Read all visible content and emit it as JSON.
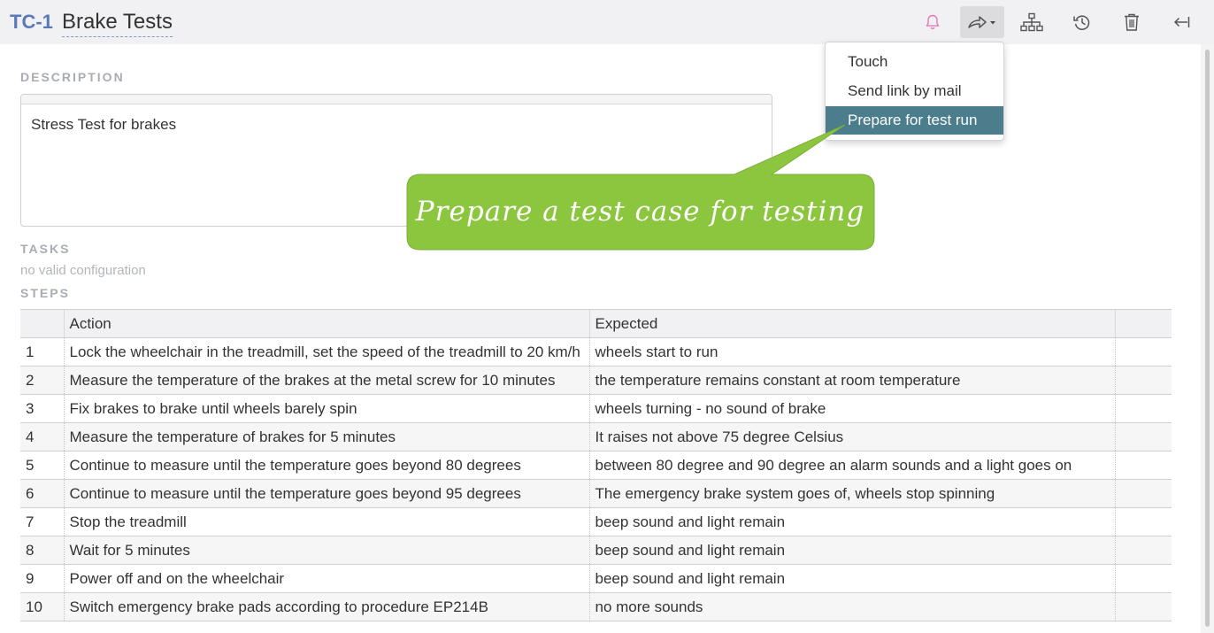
{
  "header": {
    "id": "TC-1",
    "title": "Brake Tests"
  },
  "toolbar": {
    "icons": [
      "bell-icon",
      "share-icon",
      "hierarchy-icon",
      "history-icon",
      "trash-icon",
      "collapse-left-icon"
    ],
    "accent": "#e879b6"
  },
  "description": {
    "label": "DESCRIPTION",
    "text": "Stress Test for brakes"
  },
  "tasks": {
    "label": "TASKS",
    "note": "no valid configuration"
  },
  "steps": {
    "label": "STEPS",
    "columns": [
      "",
      "Action",
      "Expected",
      ""
    ],
    "rows": [
      {
        "num": "1",
        "action": "Lock the wheelchair in the treadmill, set the speed of the treadmill to 20 km/h",
        "expected": "wheels start to run"
      },
      {
        "num": "2",
        "action": "Measure the temperature of the brakes at the metal screw for 10 minutes",
        "expected": "the temperature remains constant at room temperature"
      },
      {
        "num": "3",
        "action": "Fix brakes to brake until wheels barely spin",
        "expected": "wheels turning - no sound of brake"
      },
      {
        "num": "4",
        "action": "Measure the temperature of brakes for 5 minutes",
        "expected": "It raises not above 75 degree Celsius"
      },
      {
        "num": "5",
        "action": "Continue to measure until the temperature goes beyond 80 degrees",
        "expected": "between 80 degree and 90 degree an alarm sounds and a light goes on"
      },
      {
        "num": "6",
        "action": "Continue to measure until the temperature goes beyond 95 degrees",
        "expected": "The emergency brake system goes of, wheels stop spinning"
      },
      {
        "num": "7",
        "action": "Stop the treadmill",
        "expected": "beep sound and light remain"
      },
      {
        "num": "8",
        "action": "Wait for 5 minutes",
        "expected": "beep sound and light remain"
      },
      {
        "num": "9",
        "action": "Power off and on the wheelchair",
        "expected": "beep sound and light remain"
      },
      {
        "num": "10",
        "action": "Switch emergency brake pads according to procedure EP214B",
        "expected": "no more sounds"
      }
    ]
  },
  "share_menu": {
    "items": [
      "Touch",
      "Send link by mail",
      "Prepare for test run"
    ],
    "selected": "Prepare for test run",
    "selected_color": "#4b7d8c"
  },
  "callout": {
    "text": "Prepare a test case for testing",
    "color": "#8cc63e"
  }
}
